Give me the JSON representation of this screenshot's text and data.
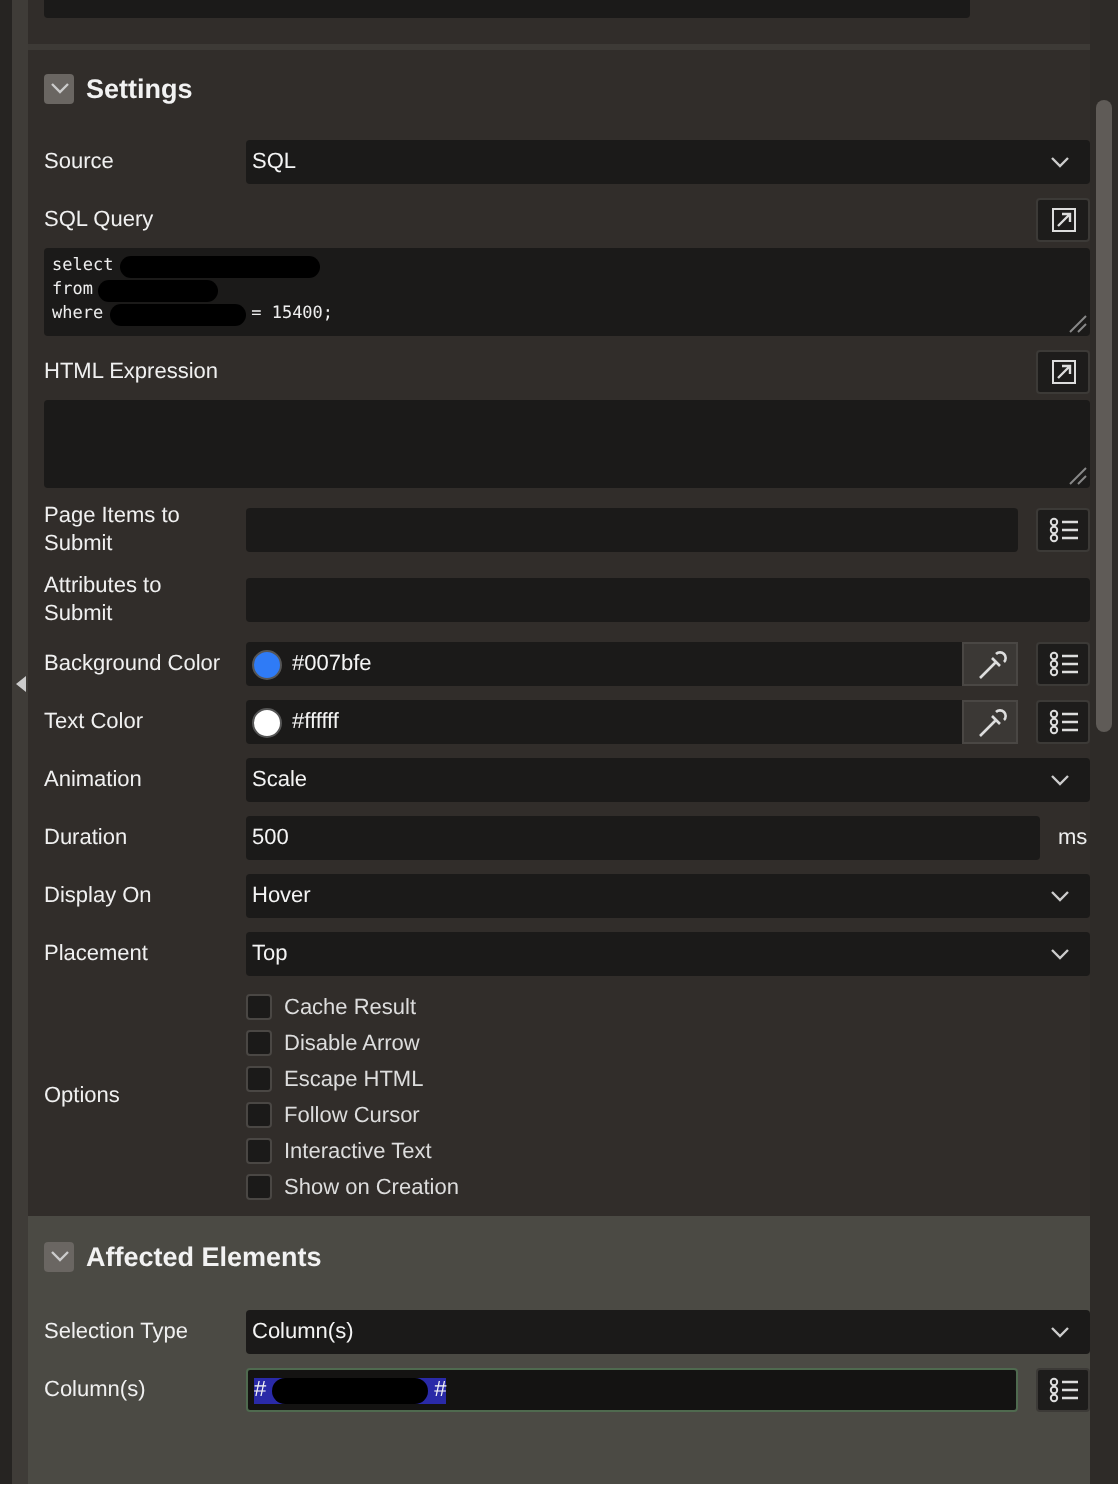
{
  "sections": [
    {
      "title": "Settings",
      "expanded": true,
      "rows": [
        {
          "kind": "select",
          "label": "Source",
          "value": "SQL"
        },
        {
          "kind": "code",
          "label": "SQL Query",
          "lines": [
            {
              "text": "select",
              "redacted": true
            },
            {
              "text": "from",
              "redacted": true
            },
            {
              "text": "where",
              "redacted": true,
              "after": "= 15400;"
            }
          ]
        },
        {
          "kind": "textarea",
          "label": "HTML Expression"
        },
        {
          "kind": "list-field",
          "label": "Page Items to Submit"
        },
        {
          "kind": "text",
          "label": "Attributes to Submit"
        },
        {
          "kind": "color",
          "label": "Background Color",
          "value": "#007bfe",
          "color": "#2f7bf6"
        },
        {
          "kind": "color",
          "label": "Text Color",
          "value": "#ffffff",
          "color": "#ffffff"
        },
        {
          "kind": "select",
          "label": "Animation",
          "value": "Scale"
        },
        {
          "kind": "number",
          "label": "Duration",
          "value": "500",
          "unit": "ms"
        },
        {
          "kind": "select",
          "label": "Display On",
          "value": "Hover"
        },
        {
          "kind": "select",
          "label": "Placement",
          "value": "Top"
        },
        {
          "kind": "checkboxes",
          "label": "Options",
          "options": [
            {
              "label": "Cache Result",
              "checked": false
            },
            {
              "label": "Disable Arrow",
              "checked": false
            },
            {
              "label": "Escape HTML",
              "checked": false
            },
            {
              "label": "Follow Cursor",
              "checked": false
            },
            {
              "label": "Interactive Text",
              "checked": false
            },
            {
              "label": "Show on Creation",
              "checked": false
            }
          ]
        }
      ]
    },
    {
      "title": "Affected Elements",
      "expanded": true,
      "rows": [
        {
          "kind": "select",
          "label": "Selection Type",
          "value": "Column(s)"
        },
        {
          "kind": "list-field",
          "label": "Column(s)",
          "focused": true,
          "value_parts": [
            "#",
            "#"
          ],
          "selected": true
        }
      ]
    }
  ]
}
